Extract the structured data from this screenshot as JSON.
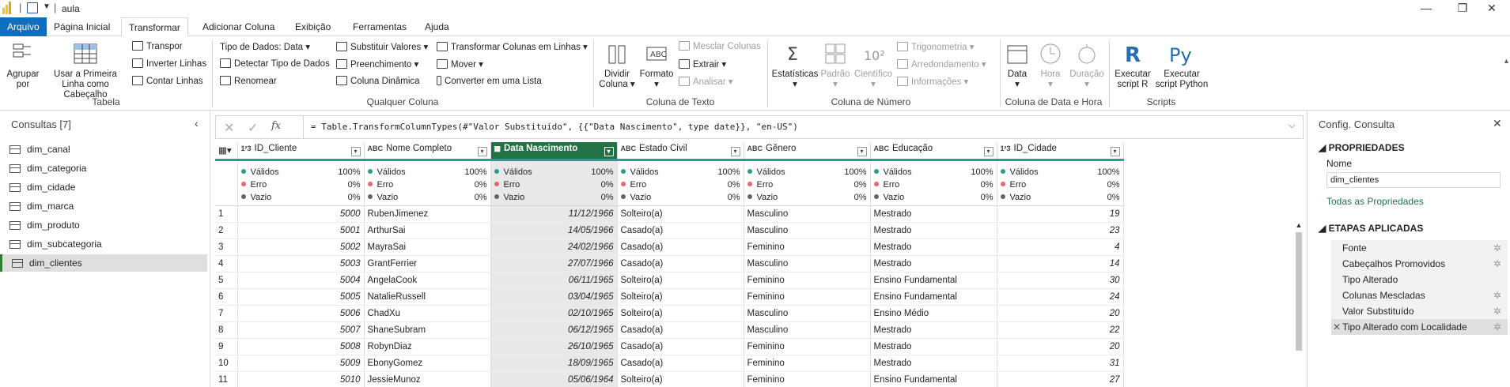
{
  "window": {
    "title": "aula"
  },
  "tabs": [
    "Arquivo",
    "Página Inicial",
    "Transformar",
    "Adicionar Coluna",
    "Exibição",
    "Ferramentas",
    "Ajuda"
  ],
  "ribbon": {
    "tabela": {
      "agrupar": "Agrupar por",
      "primeira_linha": "Usar a Primeira Linha como Cabeçalho",
      "transpor": "Transpor",
      "inverter": "Inverter Linhas",
      "contar": "Contar Linhas",
      "label": "Tabela"
    },
    "qualquer": {
      "tipo_dados": "Tipo de Dados: Data",
      "detectar": "Detectar Tipo de Dados",
      "renomear": "Renomear",
      "substituir": "Substituir Valores",
      "preenchimento": "Preenchimento",
      "coluna_dinamica": "Coluna Dinâmica",
      "transformar_colunas": "Transformar Colunas em Linhas",
      "mover": "Mover",
      "converter_lista": "Converter em uma Lista",
      "label": "Qualquer Coluna"
    },
    "texto": {
      "dividir": "Dividir Coluna",
      "formato": "Formato",
      "mesclar": "Mesclar Colunas",
      "extrair": "Extrair",
      "analisar": "Analisar",
      "label": "Coluna de Texto"
    },
    "numero": {
      "estatisticas": "Estatísticas",
      "padrao": "Padrão",
      "cientifico": "Científico",
      "trigonometria": "Trigonometria",
      "arredondamento": "Arredondamento",
      "informacoes": "Informações",
      "label": "Coluna de Número"
    },
    "data": {
      "data": "Data",
      "hora": "Hora",
      "duracao": "Duração",
      "label": "Coluna de Data e Hora"
    },
    "scripts": {
      "r": "Executar script R",
      "python": "Executar script Python",
      "label": "Scripts"
    }
  },
  "queries": {
    "title": "Consultas [7]",
    "items": [
      "dim_canal",
      "dim_categoria",
      "dim_cidade",
      "dim_marca",
      "dim_produto",
      "dim_subcategoria",
      "dim_clientes"
    ],
    "selected": "dim_clientes"
  },
  "formula": "= Table.TransformColumnTypes(#\"Valor Substituído\", {{\"Data Nascimento\", type date}}, \"en-US\")",
  "grid": {
    "columns": [
      {
        "type": "1²3",
        "name": "ID_Cliente"
      },
      {
        "type": "ABC",
        "name": "Nome Completo"
      },
      {
        "type": "▦",
        "name": "Data Nascimento"
      },
      {
        "type": "ABC",
        "name": "Estado Civil"
      },
      {
        "type": "ABC",
        "name": "Gênero"
      },
      {
        "type": "ABC",
        "name": "Educação"
      },
      {
        "type": "1²3",
        "name": "ID_Cidade"
      }
    ],
    "quality": {
      "validos": "Válidos",
      "erro": "Erro",
      "vazio": "Vazio",
      "v100": "100%",
      "v0": "0%"
    },
    "rows": [
      [
        "1",
        "5000",
        "RubenJimenez",
        "11/12/1966",
        "Solteiro(a)",
        "Masculino",
        "Mestrado",
        "19"
      ],
      [
        "2",
        "5001",
        "ArthurSai",
        "14/05/1966",
        "Casado(a)",
        "Masculino",
        "Mestrado",
        "23"
      ],
      [
        "3",
        "5002",
        "MayraSai",
        "24/02/1966",
        "Casado(a)",
        "Feminino",
        "Mestrado",
        "4"
      ],
      [
        "4",
        "5003",
        "GrantFerrier",
        "27/07/1966",
        "Casado(a)",
        "Masculino",
        "Mestrado",
        "14"
      ],
      [
        "5",
        "5004",
        "AngelaCook",
        "06/11/1965",
        "Solteiro(a)",
        "Feminino",
        "Ensino Fundamental",
        "30"
      ],
      [
        "6",
        "5005",
        "NatalieRussell",
        "03/04/1965",
        "Solteiro(a)",
        "Feminino",
        "Ensino Fundamental",
        "24"
      ],
      [
        "7",
        "5006",
        "ChadXu",
        "02/10/1965",
        "Solteiro(a)",
        "Masculino",
        "Ensino Médio",
        "20"
      ],
      [
        "8",
        "5007",
        "ShaneSubram",
        "06/12/1965",
        "Casado(a)",
        "Masculino",
        "Mestrado",
        "22"
      ],
      [
        "9",
        "5008",
        "RobynDiaz",
        "26/10/1965",
        "Casado(a)",
        "Feminino",
        "Mestrado",
        "20"
      ],
      [
        "10",
        "5009",
        "EbonyGomez",
        "18/09/1965",
        "Casado(a)",
        "Feminino",
        "Mestrado",
        "31"
      ],
      [
        "11",
        "5010",
        "JessieMunoz",
        "05/06/1964",
        "Solteiro(a)",
        "Feminino",
        "Ensino Fundamental",
        "27"
      ]
    ]
  },
  "settings": {
    "title": "Config. Consulta",
    "propriedades": "PROPRIEDADES",
    "nome_label": "Nome",
    "nome_value": "dim_clientes",
    "todas": "Todas as Propriedades",
    "etapas": "ETAPAS APLICADAS",
    "steps": [
      {
        "name": "Fonte",
        "gear": true
      },
      {
        "name": "Cabeçalhos Promovidos",
        "gear": true
      },
      {
        "name": "Tipo Alterado",
        "gear": false
      },
      {
        "name": "Colunas Mescladas",
        "gear": true
      },
      {
        "name": "Valor Substituído",
        "gear": true
      },
      {
        "name": "Tipo Alterado com Localidade",
        "gear": true
      }
    ]
  },
  "colors": {
    "accent": "#217346",
    "quality_bar": "#2e9b8f",
    "valid": "#2e9b8f",
    "error": "#e8656c",
    "empty": "#666666"
  }
}
